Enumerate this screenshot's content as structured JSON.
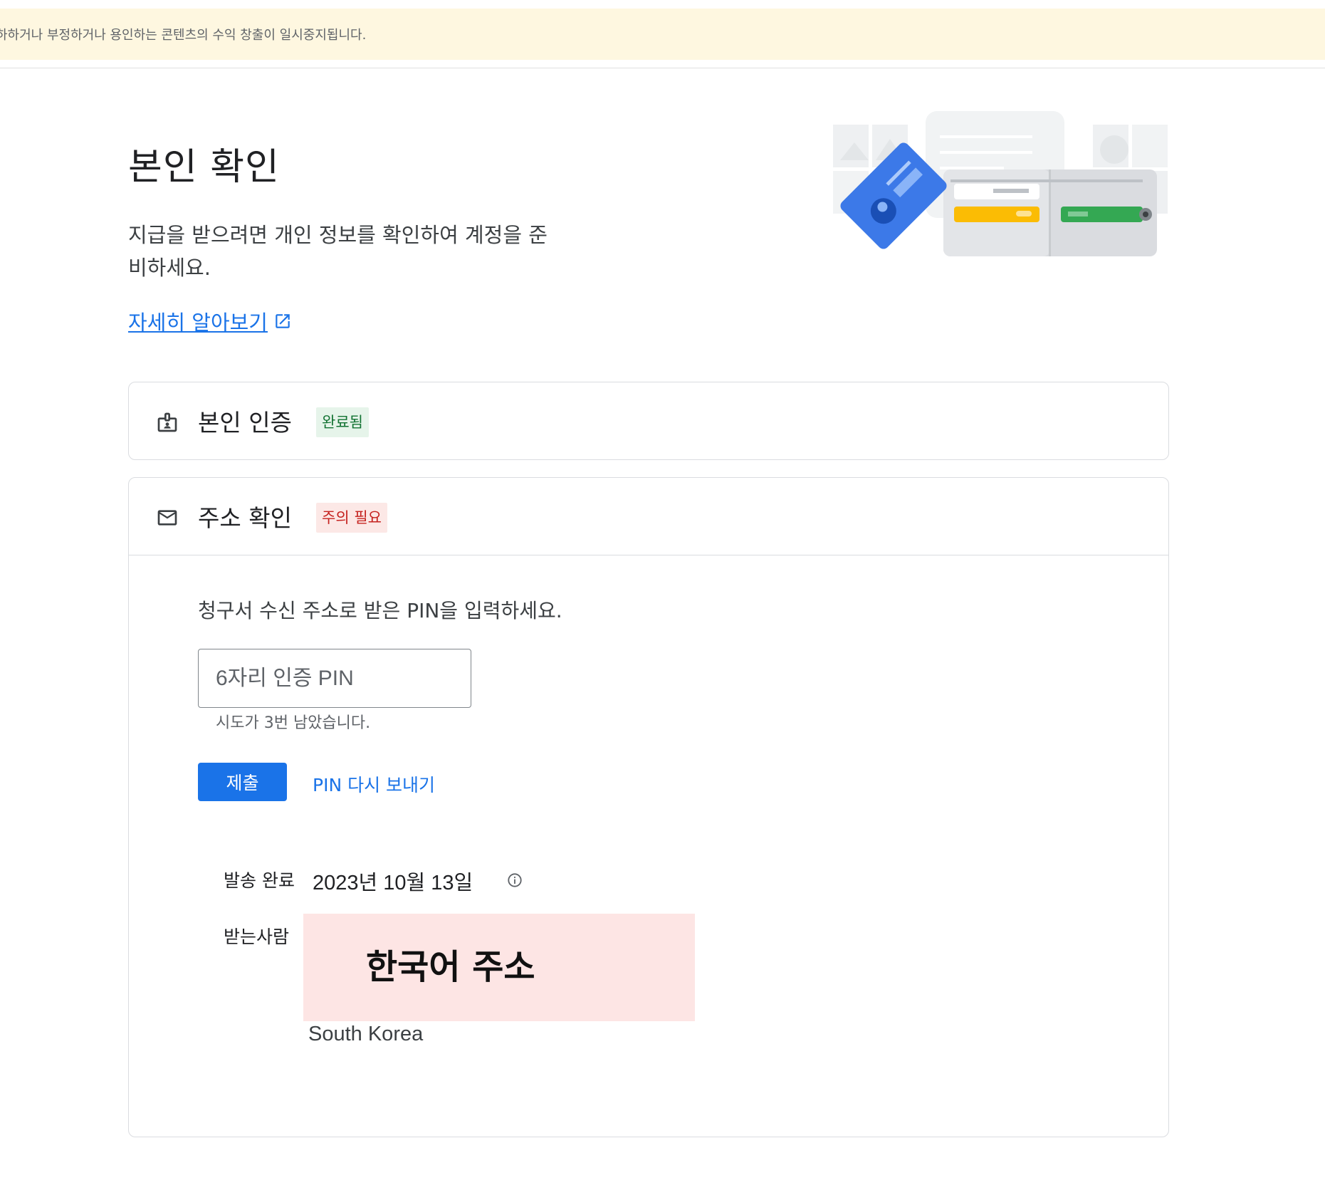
{
  "banner": {
    "text": "하하거나 부정하거나 용인하는 콘텐츠의 수익 창출이 일시중지됩니다."
  },
  "header": {
    "title": "본인 확인",
    "subtitle": "지급을 받으려면 개인 정보를 확인하여 계정을 준비하세요.",
    "learn_more": "자세히 알아보기"
  },
  "identity_card": {
    "title": "본인 인증",
    "badge": "완료됨"
  },
  "address_card": {
    "title": "주소 확인",
    "badge": "주의 필요",
    "instruction": "청구서 수신 주소로 받은 PIN을 입력하세요.",
    "pin_placeholder": "6자리 인증 PIN",
    "pin_value": "",
    "attempts": "시도가 3번 남았습니다.",
    "submit_label": "제출",
    "resend_label": "PIN 다시 보내기",
    "sent_label": "발송 완료",
    "sent_date": "2023년 10월 13일",
    "recipient_label": "받는사람",
    "redacted_address": "한국어 주소",
    "country": "South Korea"
  },
  "colors": {
    "accent": "#1a73e8",
    "banner_bg": "#fef7e0",
    "success_bg": "#e6f4ea",
    "success_text": "#137333",
    "warning_bg": "#fce8e6",
    "warning_text": "#c5221f",
    "redaction_bg": "#fde5e4"
  },
  "icons": {
    "identity": "id-badge-icon",
    "address": "mail-icon",
    "external_link": "external-link-icon",
    "info": "info-icon"
  }
}
